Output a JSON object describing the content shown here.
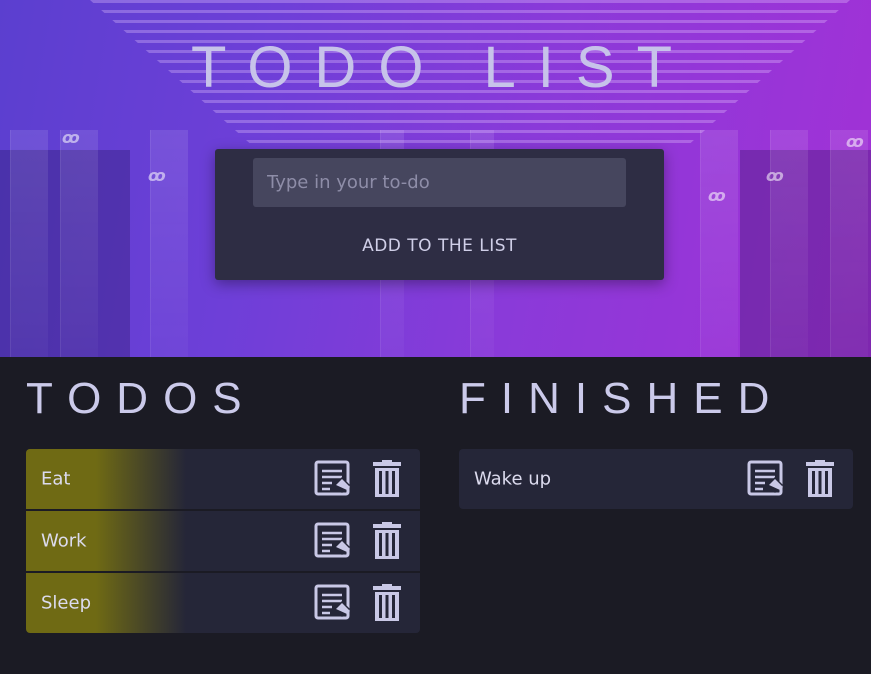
{
  "header": {
    "title": "TODO LIST"
  },
  "form": {
    "placeholder": "Type in your to-do",
    "value": "",
    "add_button_label": "ADD TO THE LIST"
  },
  "todos": {
    "title": "TODOS",
    "items": [
      {
        "label": "Eat",
        "edit_icon": "edit-note-icon",
        "delete_icon": "trash-icon"
      },
      {
        "label": "Work",
        "edit_icon": "edit-note-icon",
        "delete_icon": "trash-icon"
      },
      {
        "label": "Sleep",
        "edit_icon": "edit-note-icon",
        "delete_icon": "trash-icon"
      }
    ]
  },
  "finished": {
    "title": "FINISHED",
    "items": [
      {
        "label": "Wake up",
        "edit_icon": "edit-note-icon",
        "delete_icon": "trash-icon"
      }
    ]
  },
  "colors": {
    "hero_gradient_start": "#5b3fcf",
    "hero_gradient_end": "#a231d6",
    "page_background": "#1b1b24",
    "card_background": "#2e2d44",
    "item_background": "#252638",
    "pending_accent": "#6f6a14",
    "text": "#c9c8e6"
  }
}
